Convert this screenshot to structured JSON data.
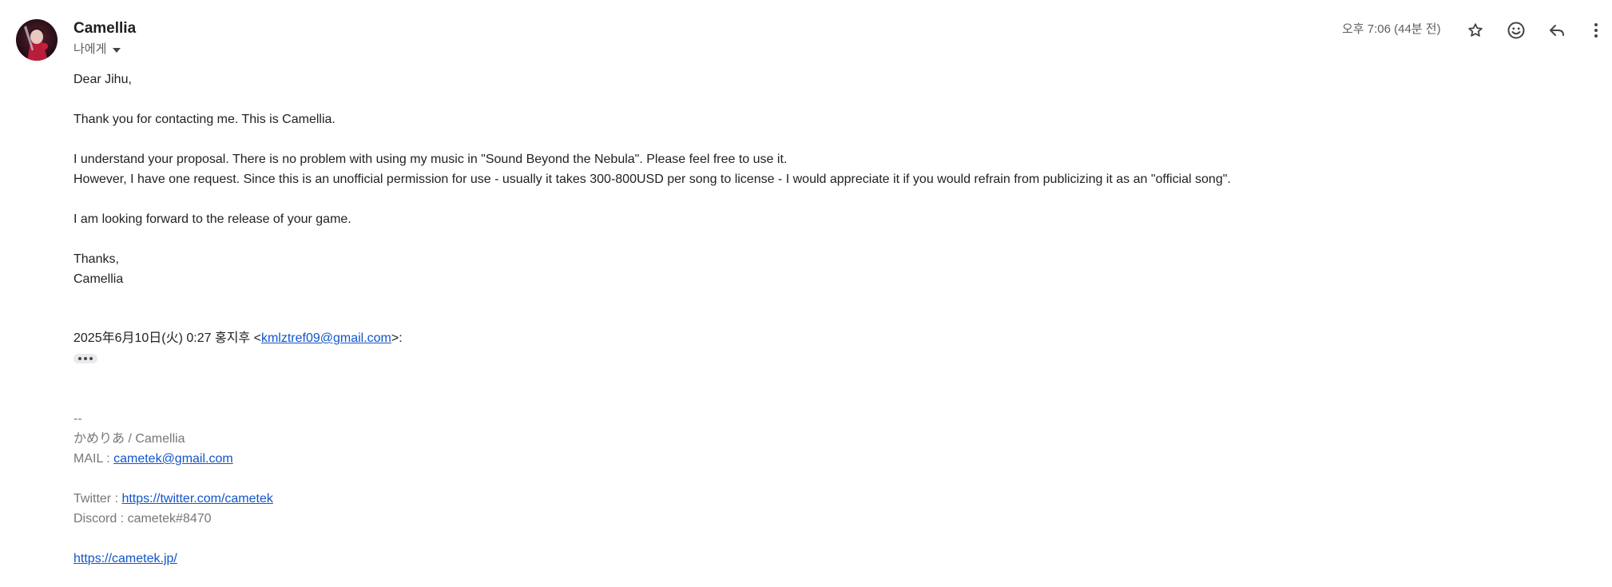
{
  "sender": {
    "name": "Camellia",
    "recipient_label": "나에게"
  },
  "header": {
    "timestamp": "오후 7:06 (44분 전)"
  },
  "icons": {
    "star": "star-icon",
    "emoji": "emoji-icon",
    "reply": "reply-icon",
    "more": "more-vert-icon"
  },
  "body": {
    "greeting": "Dear Jihu,",
    "p1": "Thank you for contacting me. This is Camellia.",
    "p2_line1": "I understand your proposal. There is no problem with using my music in \"Sound Beyond the Nebula\". Please feel free to use it.",
    "p2_line2": "However, I have one request. Since this is an unofficial permission for use - usually it takes 300-800USD per song to license - I would appreciate it if you would refrain from publicizing it as an \"official song\".",
    "p3": "I am looking forward to the release of your game.",
    "closing": "Thanks,",
    "sign": "Camellia"
  },
  "quote": {
    "prefix": "2025年6月10日(火) 0:27 홍지후 <",
    "email": "kmlztref09@gmail.com",
    "suffix": ">:"
  },
  "signature": {
    "dashes": "--",
    "name": "かめりあ / Camellia",
    "mail_label": "MAIL : ",
    "mail": "cametek@gmail.com",
    "twitter_label": "Twitter : ",
    "twitter": "https://twitter.com/cametek",
    "discord": "Discord : cametek#8470",
    "website": "https://cametek.jp/"
  },
  "colors": {
    "link": "#1155cc",
    "signature_text": "#777777"
  }
}
